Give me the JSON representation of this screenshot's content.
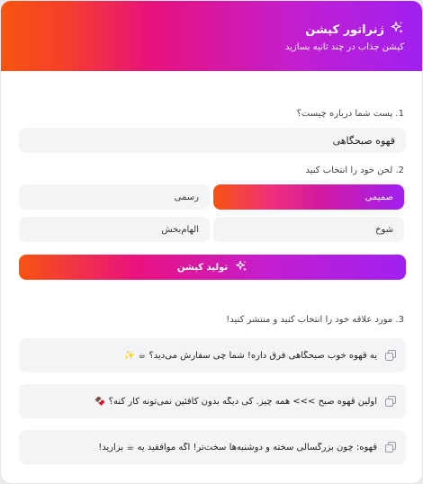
{
  "header": {
    "title": "ژنراتور کپشن",
    "subtitle": "کپشن جذاب در چند ثانیه بسازید",
    "icon": "sparkles-icon"
  },
  "step1": {
    "label": "1. پست شما درباره چیست؟",
    "value": "قهوه صبحگاهی"
  },
  "step2": {
    "label": "2. لحن خود را انتخاب کنید",
    "tones": [
      {
        "label": "صمیمی",
        "active": true
      },
      {
        "label": "رسمی",
        "active": false
      },
      {
        "label": "شوخ",
        "active": false
      },
      {
        "label": "الهام‌بخش",
        "active": false
      }
    ]
  },
  "generate": {
    "label": "تولید کپشن",
    "icon": "sparkles-icon"
  },
  "step3": {
    "label": "3. مورد علاقه خود را انتخاب کنید و منتشر کنید!",
    "captions": [
      {
        "text": "یه قهوه خوب صبحگاهی فرق داره! شما چی سفارش می‌دید؟ ☕ ✨"
      },
      {
        "text": "اولین قهوه صبح >>> همه چیز. کی دیگه بدون کافئین نمی‌تونه کار کنه؟ 🍫"
      },
      {
        "text": "قهوه: چون بزرگسالی سخته و دوشنبه‌ها سخت‌تر! اگه موافقید یه ☕ بزارید!"
      }
    ]
  },
  "colors": {
    "gradient_start": "#a020f0",
    "gradient_mid": "#e8127a",
    "gradient_end": "#f75410"
  }
}
